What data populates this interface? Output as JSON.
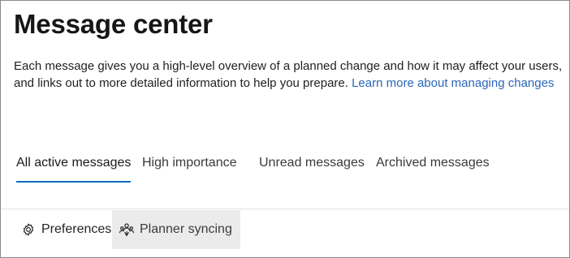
{
  "page": {
    "title": "Message center",
    "description": "Each message gives you a high-level overview of a planned change and how it may affect your users, and links out to more detailed information to help you prepare.",
    "learn_more_link": "Learn more about managing changes"
  },
  "tabs": [
    {
      "label": "All active messages",
      "active": true
    },
    {
      "label": "High importance",
      "active": false
    },
    {
      "label": "Unread messages",
      "active": false
    },
    {
      "label": "Archived messages",
      "active": false
    }
  ],
  "toolbar": {
    "preferences": {
      "label": "Preferences",
      "icon": "gear-icon"
    },
    "planner_syncing": {
      "label": "Planner syncing",
      "icon": "planner-sync-icon",
      "pressed": true
    }
  },
  "colors": {
    "accent": "#0f6cbd",
    "link": "#2b66b8",
    "pressed_bg": "#ebebeb"
  }
}
